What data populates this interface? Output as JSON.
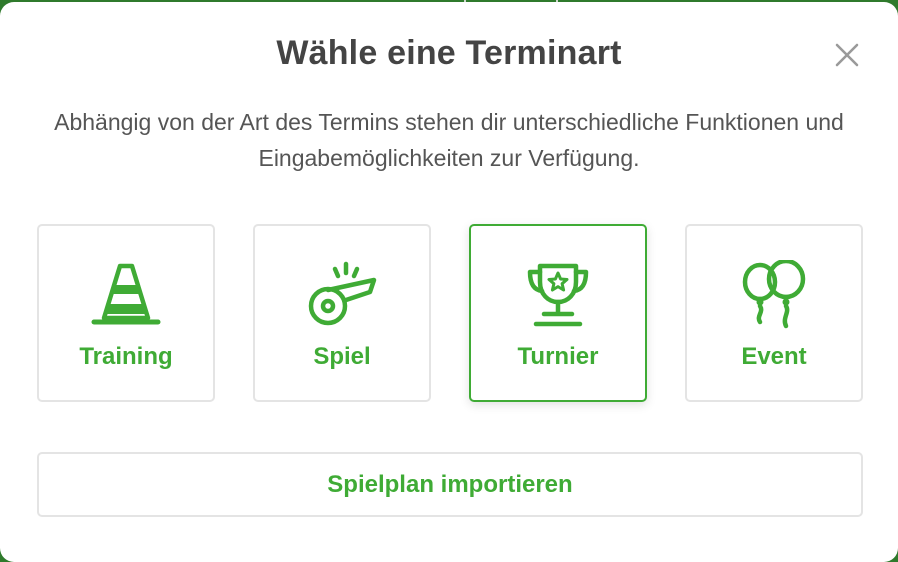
{
  "modal": {
    "title": "Wähle eine Terminart",
    "close_icon": "close-icon",
    "description_line1": "Abhängig von der Art des Termins stehen dir unterschiedliche Funktionen und",
    "description_line2": "Eingabemöglichkeiten zur Verfügung."
  },
  "event_types": [
    {
      "label": "Training",
      "icon": "traffic-cone-icon",
      "selected": false
    },
    {
      "label": "Spiel",
      "icon": "whistle-icon",
      "selected": false
    },
    {
      "label": "Turnier",
      "icon": "trophy-icon",
      "selected": true
    },
    {
      "label": "Event",
      "icon": "balloons-icon",
      "selected": false
    }
  ],
  "import_button": {
    "label": "Spielplan importieren"
  },
  "colors": {
    "accent": "#3fab35",
    "title_text": "#444444",
    "body_text": "#555555",
    "card_border": "#e4e4e4",
    "backdrop": "#2f7a2c"
  }
}
